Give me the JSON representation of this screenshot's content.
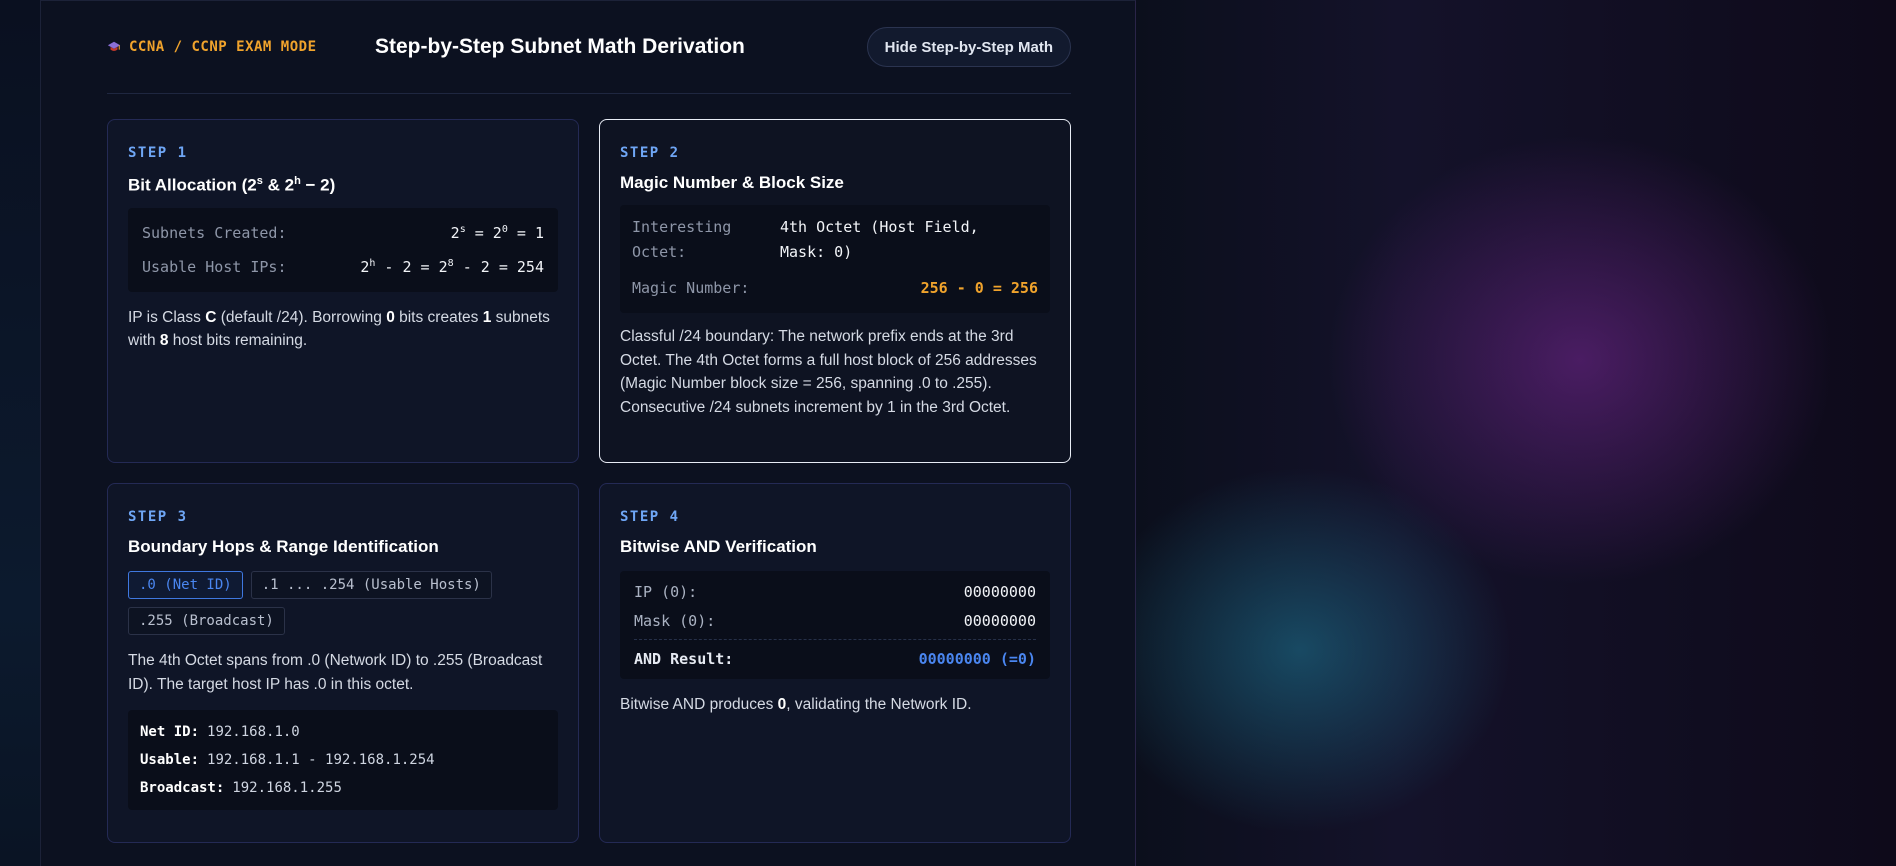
{
  "header": {
    "mode_label": "CCNA / CCNP EXAM MODE",
    "title": "Step-by-Step Subnet Math Derivation",
    "hide_button": "Hide Step-by-Step Math"
  },
  "step1": {
    "label": "STEP 1",
    "title_prefix": "Bit Allocation (2",
    "title_sup1": "s",
    "title_mid": " & 2",
    "title_sup2": "h",
    "title_suffix": " − 2)",
    "subnets_label": "Subnets Created:",
    "subnets_a": "2",
    "subnets_sup_a": "s",
    "subnets_b": " = 2",
    "subnets_sup_b": "0",
    "subnets_c": " = 1",
    "hosts_label": "Usable Host IPs:",
    "hosts_a": "2",
    "hosts_sup_a": "h",
    "hosts_b": " - 2 = 2",
    "hosts_sup_b": "8",
    "hosts_c": " - 2 = 254",
    "desc_1": "IP is Class ",
    "desc_class": "C",
    "desc_2": " (default /24). Borrowing ",
    "desc_borrow": "0",
    "desc_3": " bits creates ",
    "desc_subnets": "1",
    "desc_4": " subnets with ",
    "desc_hostbits": "8",
    "desc_5": " host bits remaining."
  },
  "step2": {
    "label": "STEP 2",
    "title": "Magic Number & Block Size",
    "octet_label_1": "Interesting",
    "octet_label_2": "Octet:",
    "octet_value_1": "4th Octet (Host Field,",
    "octet_value_2": "Mask: 0)",
    "magic_label": "Magic Number:",
    "magic_value": "256 - 0 = 256",
    "desc": "Classful /24 boundary: The network prefix ends at the 3rd Octet. The 4th Octet forms a full host block of 256 addresses (Magic Number block size = 256, spanning .0 to .255). Consecutive /24 subnets increment by 1 in the 3rd Octet."
  },
  "step3": {
    "label": "STEP 3",
    "title": "Boundary Hops & Range Identification",
    "chips": [
      ".0 (Net ID)",
      ".1 ... .254 (Usable Hosts)",
      ".255 (Broadcast)"
    ],
    "desc": "The 4th Octet spans from .0 (Network ID) to .255 (Broadcast ID). The target host IP has .0 in this octet.",
    "net_label": "Net ID:",
    "net_value": "192.168.1.0",
    "usable_label": "Usable:",
    "usable_value": "192.168.1.1 - 192.168.1.254",
    "broadcast_label": "Broadcast:",
    "broadcast_value": "192.168.1.255"
  },
  "step4": {
    "label": "STEP 4",
    "title": "Bitwise AND Verification",
    "ip_label": "IP (0):",
    "ip_value": "00000000",
    "mask_label": "Mask (0):",
    "mask_value": "00000000",
    "result_label": "AND Result:",
    "result_value": "00000000 (=0)",
    "desc_1": "Bitwise AND produces ",
    "desc_value": "0",
    "desc_2": ", validating the Network ID."
  },
  "colors": {
    "accent_orange": "#f0a32c",
    "accent_blue": "#4a86f0",
    "step_label": "#6fa6f5"
  }
}
